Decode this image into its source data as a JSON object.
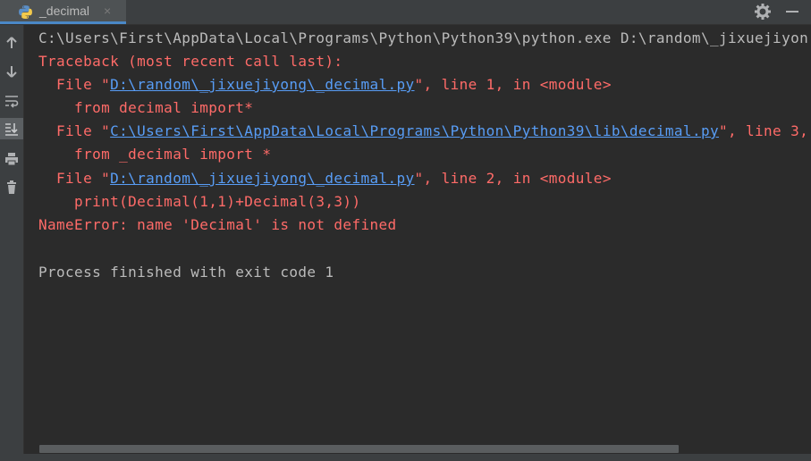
{
  "tab": {
    "label": "_decimal",
    "close": "×",
    "icon": "python-file-icon"
  },
  "toolbar_icons": [
    "gear-icon",
    "minimize-icon"
  ],
  "sidebar": [
    {
      "name": "up-arrow-icon"
    },
    {
      "name": "down-arrow-icon"
    },
    {
      "name": "soft-wrap-icon"
    },
    {
      "name": "scroll-to-end-icon",
      "active": true
    },
    {
      "name": "print-icon"
    },
    {
      "name": "trash-icon"
    }
  ],
  "console": {
    "command": "C:\\Users\\First\\AppData\\Local\\Programs\\Python\\Python39\\python.exe D:\\random\\_jixuejiyon",
    "traceback_header": "Traceback (most recent call last):",
    "frame1": {
      "prefix": "  File \"",
      "path": "D:\\random\\_jixuejiyong\\_decimal.py",
      "suffix": "\", line 1, in <module>",
      "code": "    from decimal import*"
    },
    "frame2": {
      "prefix": "  File \"",
      "path": "C:\\Users\\First\\AppData\\Local\\Programs\\Python\\Python39\\lib\\decimal.py",
      "suffix": "\", line 3,",
      "code": "    from _decimal import *"
    },
    "frame3": {
      "prefix": "  File \"",
      "path": "D:\\random\\_jixuejiyong\\_decimal.py",
      "suffix": "\", line 2, in <module>",
      "code": "    print(Decimal(1,1)+Decimal(3,3))"
    },
    "error": "NameError: name 'Decimal' is not defined",
    "exit": "Process finished with exit code 1"
  },
  "colors": {
    "background": "#2b2b2b",
    "error": "#ff6b68",
    "link": "#589df6",
    "text": "#bbbbbb"
  }
}
